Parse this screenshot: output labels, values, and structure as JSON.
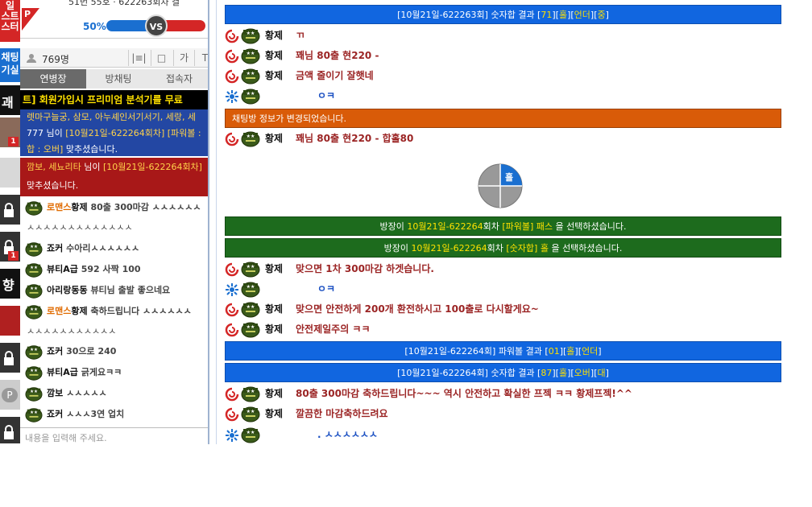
{
  "leftstrip": {
    "top_label": "일\n스트\n스터",
    "chat_label": "채팅\n기실",
    "thumb_badges": [
      "1",
      "1"
    ]
  },
  "vs": {
    "percent": "50%",
    "vs_label": "VS",
    "p_label": "P",
    "top_cut_text": "51번 55호 · 622263회차 결"
  },
  "counter": {
    "users": "769명",
    "tools": [
      "|≡|○",
      "□",
      "가",
      "T"
    ]
  },
  "tabs": [
    "연병장",
    "방채팅",
    "접속자"
  ],
  "notice": "트] 회원가입시 프리미엄 분석기를 무료",
  "win_blue": {
    "line1": "렛마구늘궁, 삼모, 아누셰인서기서기, 세랑, 세",
    "line2_prefix": "777 님이 ",
    "line2_y": "[10월21일-622264회차] [파워볼 : ",
    "line3_y": "합 : 오버]",
    "line3_suffix": " 맞추셨습니다."
  },
  "win_red": {
    "line1_y": "깜보, 세뇨리타",
    "line1_mid": " 님이 ",
    "line1_y2": "[10월21일-622264회차]",
    "line2": "맞추셨습니다."
  },
  "left_messages": [
    {
      "nick_or": "로맨스",
      "nick": "황제",
      "text": " 80출 300마감 ㅅㅅㅅㅅㅅㅅ"
    },
    {
      "cont": "ㅅㅅㅅㅅㅅㅅㅅㅅㅅㅅㅅㅅㅅ"
    },
    {
      "nick_or": "",
      "nick": "죠커",
      "text": " 수아리ㅅㅅㅅㅅㅅㅅ"
    },
    {
      "nick_or": "",
      "nick": "뷰티A급",
      "text": " 592  사짝 100"
    },
    {
      "nick_or": "",
      "nick": "아리랑동동",
      "text": " 뷰티님 출발 좋으네요"
    },
    {
      "nick_or": "로맨스",
      "nick": "황제",
      "text": " 축하드립니다 ㅅㅅㅅㅅㅅㅅ"
    },
    {
      "cont": "ㅅㅅㅅㅅㅅㅅㅅㅅㅅㅅㅅ"
    },
    {
      "nick_or": "",
      "nick": "죠커",
      "text": " 30으로 240"
    },
    {
      "nick_or": "",
      "nick": "뷰티A급",
      "text": " 긁게요ㅋㅋ"
    },
    {
      "nick_or": "",
      "nick": "깜보",
      "text": " ㅅㅅㅅㅅㅅ"
    },
    {
      "nick_or": "",
      "nick": "죠커",
      "text": " ㅅㅅㅅ3연 업치"
    }
  ],
  "input_placeholder": "내용을 입력해 주세요.",
  "right": {
    "bar1": {
      "pre": "[10월21일-622263회] 숫자합 결과 [",
      "y1": "71",
      "mid": "][",
      "y2": "홀",
      "mid2": "][",
      "y3": "언더",
      "mid3": "][",
      "y4": "중",
      "post": "]"
    },
    "msgs1": [
      {
        "name": "황제",
        "text": "ㄲ"
      },
      {
        "name": "황제",
        "text": "꽤님 80출 현220 -"
      },
      {
        "name": "황제",
        "text": "금액 줄이기 잘햇네"
      },
      {
        "name": "",
        "text": "ㅇㅋ",
        "blue": true
      }
    ],
    "orange_bar": "채팅방 정보가 변경되었습니다.",
    "msg_after_orange": {
      "name": "황제",
      "text": "꽤님 80출 현220 - 합홀80"
    },
    "pie_label": "홀",
    "green1": {
      "pre": "방장이 ",
      "y1": "10월21일-622264",
      "mid": "회차 ",
      "y2": "[파워볼] 패스",
      "post": " 을 선택하셨습니다."
    },
    "green2": {
      "pre": "방장이 ",
      "y1": "10월21일-622264",
      "mid": "회차 ",
      "y2": "[숫자합] 홀",
      "post": " 을 선택하셨습니다."
    },
    "msgs2": [
      {
        "name": "황제",
        "text": "맞으면 1차 300마감 하겟습니다."
      },
      {
        "name": "",
        "text": "ㅇㅋ",
        "blue": true
      },
      {
        "name": "황제",
        "text": "맞으면 안전하게 200개 환전하시고 100출로 다시할게요~"
      },
      {
        "name": "황제",
        "text": "안전제일주의 ㅋㅋ"
      }
    ],
    "bar2": {
      "pre": "[10월21일-622264회] 파워볼 결과 [",
      "y1": "01",
      "mid": "][",
      "y2": "홀",
      "mid2": "][",
      "y3": "언더",
      "post": "]"
    },
    "bar3": {
      "pre": "[10월21일-622264회] 숫자합 결과 [",
      "y1": "87",
      "mid": "][",
      "y2": "홀",
      "mid2": "][",
      "y3": "오버",
      "mid3": "][",
      "y4": "대",
      "post": "]"
    },
    "msgs3": [
      {
        "name": "황제",
        "text": "80출 300마감 축하드립니다~~~ 역시 안전하고 확실한 프젝 ㅋㅋ 황제프젝!^^"
      },
      {
        "name": "황제",
        "text": "깔끔한 마감축하드려요"
      },
      {
        "name": "",
        "text": ". ㅅㅅㅅㅅㅅㅅ",
        "blue": true
      }
    ]
  }
}
